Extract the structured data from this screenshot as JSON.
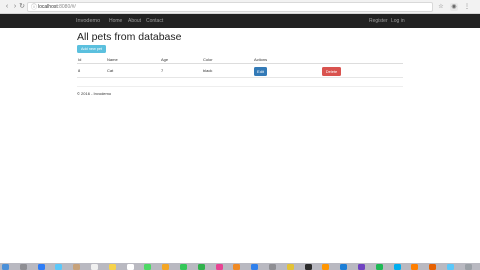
{
  "browser": {
    "url_host": "localhost",
    "url_path": ":8080/#/"
  },
  "navbar": {
    "brand": "Invodemo",
    "links": [
      "Home",
      "About",
      "Contact"
    ],
    "right_links": [
      "Register",
      "Log in"
    ]
  },
  "main": {
    "title": "All pets from database",
    "add_button": "Add new pet",
    "table": {
      "headers": [
        "Id",
        "Name",
        "Age",
        "Color",
        "Actions"
      ],
      "rows": [
        {
          "id": "8",
          "name": "Cat",
          "age": "7",
          "color": "black",
          "edit": "Edit",
          "delete": "Delete"
        }
      ]
    }
  },
  "footer": {
    "text": "© 2016 - Invodemo"
  },
  "colors": {
    "navbar": "#222222",
    "add_button": "#5bc0de",
    "edit_button": "#337ab7",
    "delete_button": "#d9534f"
  },
  "dock": {
    "icons": [
      "finder-icon",
      "launchpad-icon",
      "safari-icon",
      "mail-icon",
      "contacts-icon",
      "calendar-icon",
      "notes-icon",
      "reminders-icon",
      "maps-icon",
      "photos-icon",
      "messages-icon",
      "facetime-icon",
      "itunes-icon",
      "ibooks-icon",
      "app-store-icon",
      "system-preferences-icon",
      "chrome-icon",
      "terminal-icon",
      "sublime-icon",
      "xcode-icon",
      "slack-icon",
      "spotify-icon",
      "skype-icon",
      "vlc-icon",
      "firefox-icon",
      "downloads-icon",
      "trash-icon"
    ]
  }
}
